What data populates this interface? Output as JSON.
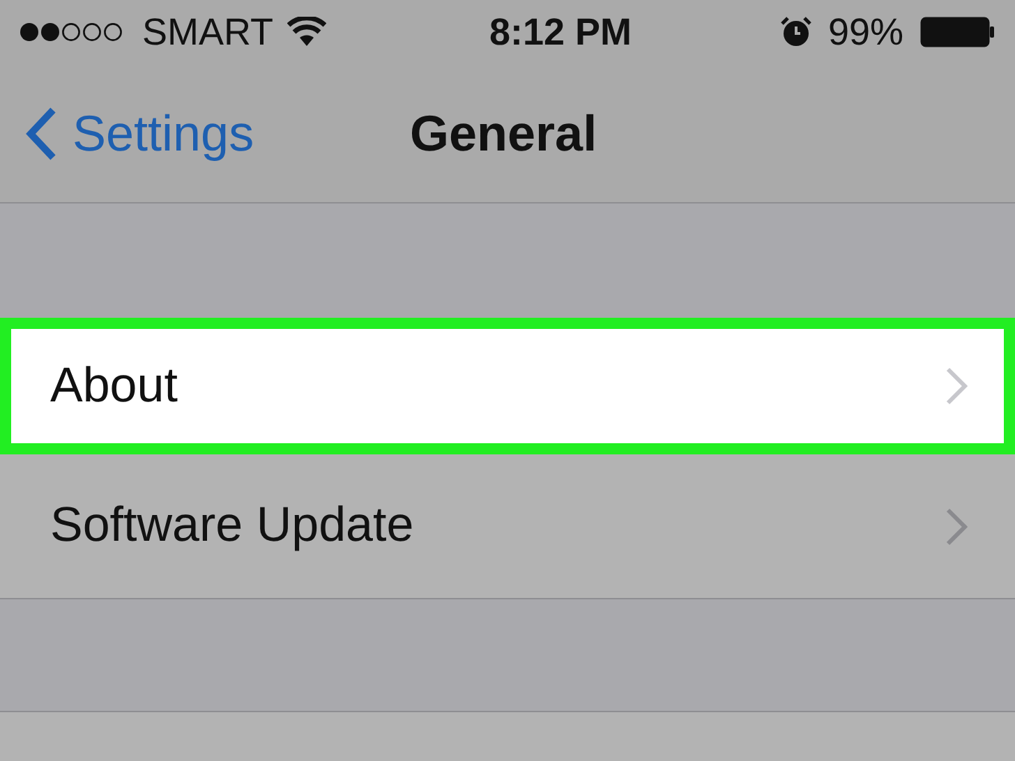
{
  "status_bar": {
    "carrier": "SMART",
    "time": "8:12 PM",
    "battery": "99%"
  },
  "nav_bar": {
    "back": "Settings",
    "title": "General"
  },
  "rows": [
    {
      "label": "About",
      "highlighted": true
    },
    {
      "label": "Software Update",
      "highlighted": false
    }
  ]
}
